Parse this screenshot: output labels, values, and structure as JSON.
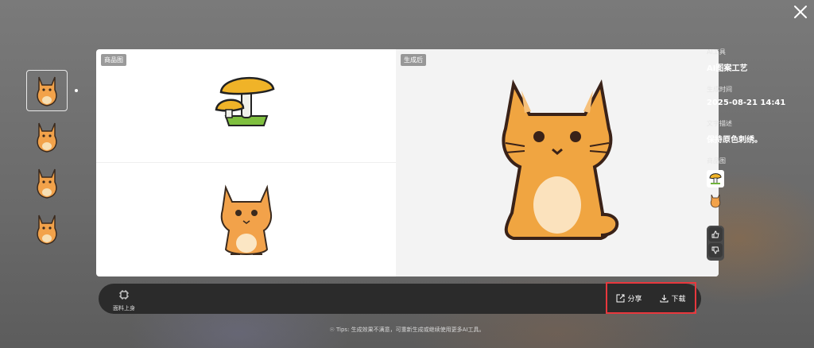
{
  "thumbnails": [
    {
      "icon": "cat-thumbnail",
      "active": true
    },
    {
      "icon": "cat-thumbnail",
      "active": false
    },
    {
      "icon": "cat-thumbnail",
      "active": false
    },
    {
      "icon": "cat-thumbnail",
      "active": false
    }
  ],
  "canvas": {
    "product_tag": "商品图",
    "result_tag": "生成后"
  },
  "info": {
    "tool_label": "AI工具",
    "tool_value": "AI图案工艺",
    "time_label": "生成时间",
    "time_value": "2025-08-21 14:41",
    "desc_label": "文字描述",
    "desc_value": "保持原色刺绣。",
    "product_label": "商品图"
  },
  "toolbar": {
    "fabric_label": "面料上身",
    "share_label": "分享",
    "download_label": "下载"
  },
  "tips": "Tips: 生成效果不满意，可重新生成或继续使用更多AI工具。",
  "colors": {
    "highlight": "#e8383d",
    "toolbar_bg": "#2b2b2b"
  }
}
